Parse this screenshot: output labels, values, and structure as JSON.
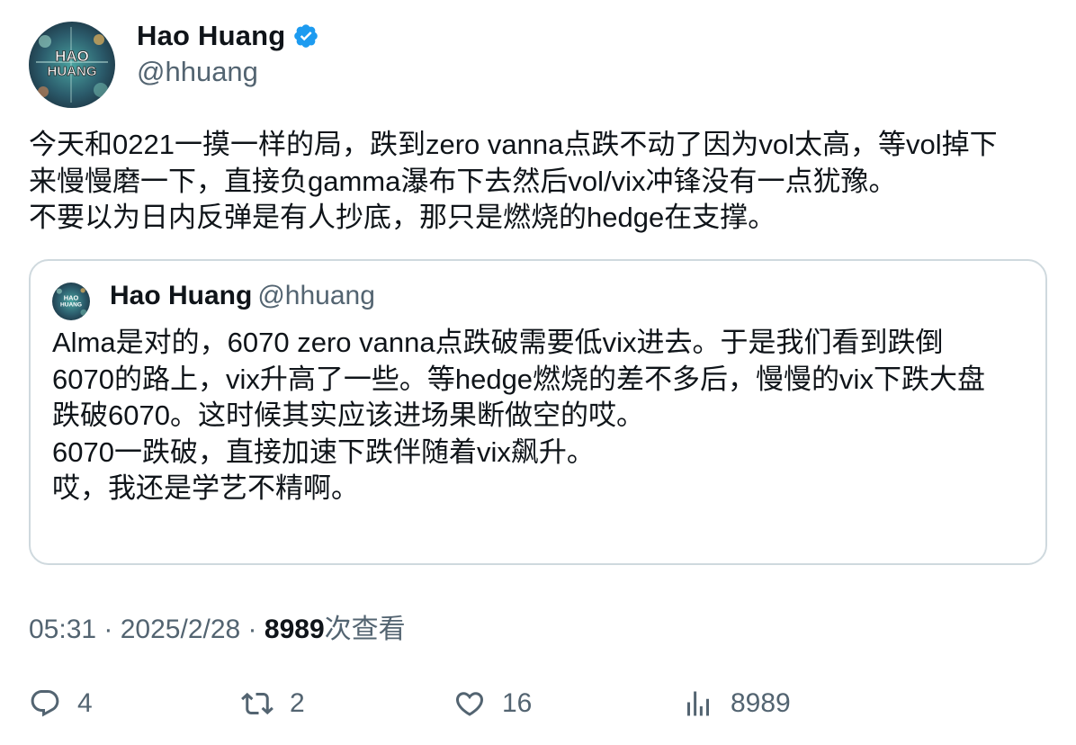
{
  "author": {
    "display_name": "Hao Huang",
    "handle": "@hhuang",
    "avatar_text_line1": "HAO",
    "avatar_text_line2": "HUANG"
  },
  "tweet": {
    "lines": [
      "今天和0221一摸一样的局，跌到zero vanna点跌不动了因为vol太高，等vol掉下",
      "来慢慢磨一下，直接负gamma瀑布下去然后vol/vix冲锋没有一点犹豫。",
      "不要以为日内反弹是有人抄底，那只是燃烧的hedge在支撑。"
    ]
  },
  "quoted": {
    "display_name": "Hao Huang",
    "handle": "@hhuang",
    "lines": [
      "Alma是对的，6070 zero vanna点跌破需要低vix进去。于是我们看到跌倒",
      "6070的路上，vix升高了一些。等hedge燃烧的差不多后，慢慢的vix下跌大盘",
      "跌破6070。这时候其实应该进场果断做空的哎。",
      "6070一跌破，直接加速下跌伴随着vix飙升。",
      "哎，我还是学艺不精啊。"
    ]
  },
  "meta": {
    "time": "05:31",
    "sep1": " · ",
    "date": "2025/2/28",
    "sep2": " · ",
    "views_count": "8989",
    "views_label": "次查看"
  },
  "actions": {
    "reply_count": "4",
    "retweet_count": "2",
    "like_count": "16",
    "views_count": "8989"
  },
  "icons": {
    "verified": "verified-badge-icon",
    "reply": "reply-icon",
    "retweet": "retweet-icon",
    "like": "heart-icon",
    "views": "bar-chart-icon"
  },
  "colors": {
    "verified": "#1d9bf0",
    "secondary_text": "#536471",
    "border": "#cfd9de"
  }
}
